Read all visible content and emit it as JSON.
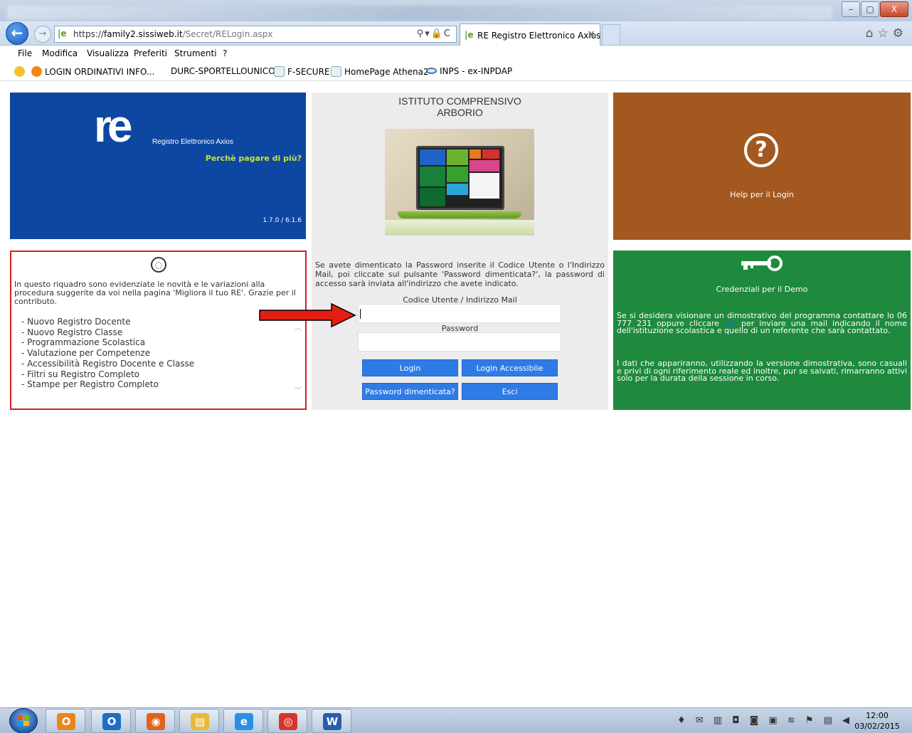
{
  "browser": {
    "url_scheme": "https://",
    "url_host": "family2.sissiweb.it",
    "url_path": "/Secret/RELogin.aspx",
    "tab_title": "RE Registro Elettronico Axios",
    "tab_close": "✕",
    "addr_tools": "⚲▾🔒C",
    "right_icons": "⌂☆⚙",
    "window_controls": {
      "minimize": "–",
      "maximize": "▢",
      "close": "X"
    }
  },
  "menu": [
    "File",
    "Modifica",
    "Visualizza",
    "Preferiti",
    "Strumenti",
    "?"
  ],
  "favorites": [
    {
      "label": "LOGIN ORDINATIVI INFO...",
      "icon": "orange-globe-icon"
    },
    {
      "label": "DURC-SPORTELLOUNICO",
      "icon": ""
    },
    {
      "label": "F-SECURE",
      "icon": "ie-page-icon"
    },
    {
      "label": "HomePage Athena2",
      "icon": "ie-page-icon"
    },
    {
      "label": "INPS - ex-INPDAP",
      "icon": "inps-icon"
    }
  ],
  "brand": {
    "logo": "re",
    "name": "Registro Elettronico Axios",
    "tagline": "Perchè pagare di più?",
    "version": "1.7.0 / 6.1.6"
  },
  "school": {
    "title_line1": "ISTITUTO COMPRENSIVO",
    "title_line2": "ARBORIO",
    "forgot_text": "Se avete dimenticato la Password inserite il Codice Utente o l'Indirizzo Mail, poi cliccate sul pulsante 'Password dimenticata?', la password di accesso sarà inviata all'indirizzo che avete indicato.",
    "user_label": "Codice Utente / Indirizzo Mail",
    "user_value": "",
    "password_label": "Password",
    "password_value": "",
    "buttons": {
      "login": "Login",
      "login_accessible": "Login Accessibile",
      "forgot": "Password dimenticata?",
      "exit": "Esci"
    }
  },
  "help": {
    "symbol": "?",
    "label": "Help per il Login"
  },
  "news": {
    "bulb": "💡",
    "intro": "In questo riquadro sono evidenziate le novità e le variazioni alla procedura suggerite da voi nella pagina 'Migliora il tuo RE'. Grazie per il contributo.",
    "items": [
      "- Nuovo Registro Docente",
      "- Nuovo Registro Classe",
      "- Programmazione Scolastica",
      "- Valutazione per Competenze",
      "- Accessibilità Registro Docente e Classe",
      "- Filtri su Registro Completo",
      "- Stampe per Registro Completo"
    ],
    "scroll_up": "︿",
    "scroll_down": "﹀"
  },
  "demo": {
    "title": "Credenziali per il Demo",
    "p1_before": "Se si desidera visionare un dimostrativo del programma contattare lo 06 777 231 oppure cliccare ",
    "p1_link": "qui",
    "p1_after": " per inviare una mail indicando il nome dell'istituzione scolastica e quello di un referente che sarà contattato.",
    "p2": "I dati che appariranno, utilizzando la versione dimostrativa, sono casuali e privi di ogni riferimento reale ed inoltre, pur se salvati, rimarranno attivi solo per la durata della sessione in corso."
  },
  "taskbar": {
    "apps": [
      {
        "name": "outlook-calendar",
        "glyph": "O",
        "color": "#e8871c"
      },
      {
        "name": "outlook",
        "glyph": "O",
        "color": "#1d6fc4"
      },
      {
        "name": "firefox",
        "glyph": "◉",
        "color": "#e0631b"
      },
      {
        "name": "explorer",
        "glyph": "▤",
        "color": "#e7bb3a"
      },
      {
        "name": "internet-explorer",
        "glyph": "e",
        "color": "#2b8fe6"
      },
      {
        "name": "chrome",
        "glyph": "◎",
        "color": "#d7352b"
      },
      {
        "name": "word",
        "glyph": "W",
        "color": "#2a5cab"
      }
    ],
    "tray": "♦ ✉ ▥ ◘ ◙ ▣ ≋ ⚑ ▤ ◀",
    "time": "12:00",
    "date": "03/02/2015"
  }
}
